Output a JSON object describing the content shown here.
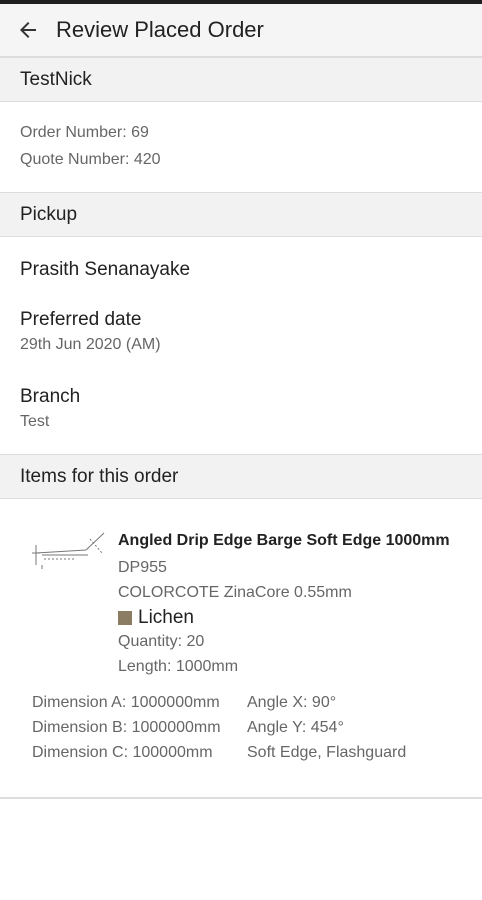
{
  "app_bar": {
    "title": "Review Placed Order"
  },
  "account": {
    "name": "TestNick",
    "order_number": "Order Number: 69",
    "quote_number": "Quote Number: 420"
  },
  "delivery": {
    "section_title": "Pickup",
    "contact_name": "Prasith Senanayake",
    "preferred_date_label": "Preferred date",
    "preferred_date_value": "29th Jun 2020 (AM)",
    "branch_label": "Branch",
    "branch_value": "Test"
  },
  "items": {
    "section_title": "Items for this order",
    "list": [
      {
        "name": "Angled Drip Edge Barge Soft Edge 1000mm",
        "code": "DP955",
        "material": "COLORCOTE ZinaCore 0.55mm",
        "colour_name": "Lichen",
        "colour_hex": "#8b7d63",
        "quantity": "Quantity: 20",
        "length": "Length: 1000mm",
        "dimension_a": "Dimension A: 1000000mm",
        "dimension_b": "Dimension B: 1000000mm",
        "dimension_c": "Dimension C: 100000mm",
        "angle_x": "Angle X: 90°",
        "angle_y": "Angle Y: 454°",
        "options": "Soft Edge, Flashguard",
        "thumbnail_icon": "flashing-profile-drawing"
      }
    ]
  }
}
